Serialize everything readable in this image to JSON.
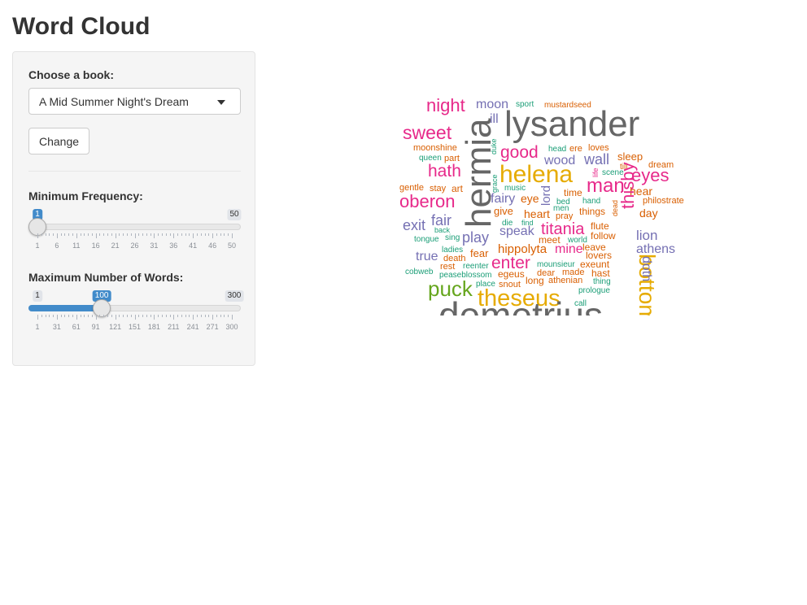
{
  "page": {
    "title": "Word Cloud"
  },
  "controls": {
    "book_label": "Choose a book:",
    "book_selected": "A Mid Summer Night's Dream",
    "change_label": "Change",
    "min_freq": {
      "label": "Minimum Frequency:",
      "min": 1,
      "max": 50,
      "value": 1,
      "min_text": "1",
      "max_text": "50",
      "value_text": "1",
      "ticks": [
        "1",
        "6",
        "11",
        "16",
        "21",
        "26",
        "31",
        "36",
        "41",
        "46",
        "50"
      ]
    },
    "max_words": {
      "label": "Maximum Number of Words:",
      "min": 1,
      "max": 300,
      "value": 100,
      "min_text": "1",
      "max_text": "300",
      "value_text": "100",
      "ticks": [
        "1",
        "31",
        "61",
        "91",
        "121",
        "151",
        "181",
        "211",
        "241",
        "271",
        "300"
      ]
    }
  },
  "colors": {
    "pink": "#e7298a",
    "orange": "#d95f02",
    "purple": "#7570b3",
    "green": "#1b9e77",
    "lime": "#66a61e",
    "gold": "#e6ab02",
    "gray": "#666666",
    "brown": "#a6761d",
    "slider_blue": "#428bca"
  },
  "wordcloud": {
    "words": [
      {
        "text": "night",
        "color": "pink"
      },
      {
        "text": "moon",
        "color": "purple"
      },
      {
        "text": "sport",
        "color": "green"
      },
      {
        "text": "mustardseed",
        "color": "orange"
      },
      {
        "text": "lysander",
        "color": "gray"
      },
      {
        "text": "sweet",
        "color": "pink"
      },
      {
        "text": "ill",
        "color": "purple"
      },
      {
        "text": "hermia",
        "color": "gray"
      },
      {
        "text": "moonshine",
        "color": "orange"
      },
      {
        "text": "duke",
        "color": "green"
      },
      {
        "text": "good",
        "color": "pink"
      },
      {
        "text": "head",
        "color": "green"
      },
      {
        "text": "ere",
        "color": "orange"
      },
      {
        "text": "loves",
        "color": "orange"
      },
      {
        "text": "queen",
        "color": "green"
      },
      {
        "text": "part",
        "color": "orange"
      },
      {
        "text": "wood",
        "color": "purple"
      },
      {
        "text": "wall",
        "color": "purple"
      },
      {
        "text": "sleep",
        "color": "orange"
      },
      {
        "text": "hath",
        "color": "pink"
      },
      {
        "text": "till",
        "color": "orange"
      },
      {
        "text": "dream",
        "color": "orange"
      },
      {
        "text": "helena",
        "color": "gold"
      },
      {
        "text": "life",
        "color": "pink"
      },
      {
        "text": "scene",
        "color": "green"
      },
      {
        "text": "eyes",
        "color": "pink"
      },
      {
        "text": "grace",
        "color": "green"
      },
      {
        "text": "man",
        "color": "pink"
      },
      {
        "text": "gentle",
        "color": "orange"
      },
      {
        "text": "stay",
        "color": "orange"
      },
      {
        "text": "art",
        "color": "orange"
      },
      {
        "text": "music",
        "color": "green"
      },
      {
        "text": "oberon",
        "color": "pink"
      },
      {
        "text": "lord",
        "color": "purple"
      },
      {
        "text": "time",
        "color": "orange"
      },
      {
        "text": "hear",
        "color": "orange"
      },
      {
        "text": "fairy",
        "color": "purple"
      },
      {
        "text": "eye",
        "color": "orange"
      },
      {
        "text": "hand",
        "color": "green"
      },
      {
        "text": "dead",
        "color": "orange"
      },
      {
        "text": "philostrate",
        "color": "orange"
      },
      {
        "text": "bed",
        "color": "green"
      },
      {
        "text": "give",
        "color": "orange"
      },
      {
        "text": "men",
        "color": "green"
      },
      {
        "text": "things",
        "color": "orange"
      },
      {
        "text": "day",
        "color": "orange"
      },
      {
        "text": "fair",
        "color": "purple"
      },
      {
        "text": "heart",
        "color": "orange"
      },
      {
        "text": "pray",
        "color": "orange"
      },
      {
        "text": "thisby",
        "color": "pink"
      },
      {
        "text": "exit",
        "color": "purple"
      },
      {
        "text": "die",
        "color": "green"
      },
      {
        "text": "find",
        "color": "green"
      },
      {
        "text": "titania",
        "color": "pink"
      },
      {
        "text": "flute",
        "color": "orange"
      },
      {
        "text": "back",
        "color": "green"
      },
      {
        "text": "speak",
        "color": "purple"
      },
      {
        "text": "lion",
        "color": "purple"
      },
      {
        "text": "tongue",
        "color": "green"
      },
      {
        "text": "sing",
        "color": "green"
      },
      {
        "text": "play",
        "color": "purple"
      },
      {
        "text": "meet",
        "color": "orange"
      },
      {
        "text": "world",
        "color": "green"
      },
      {
        "text": "follow",
        "color": "orange"
      },
      {
        "text": "athens",
        "color": "purple"
      },
      {
        "text": "ladies",
        "color": "green"
      },
      {
        "text": "hippolyta",
        "color": "orange"
      },
      {
        "text": "mine",
        "color": "pink"
      },
      {
        "text": "leave",
        "color": "orange"
      },
      {
        "text": "true",
        "color": "purple"
      },
      {
        "text": "death",
        "color": "orange"
      },
      {
        "text": "fear",
        "color": "orange"
      },
      {
        "text": "lovers",
        "color": "orange"
      },
      {
        "text": "bottom",
        "color": "gold"
      },
      {
        "text": "rest",
        "color": "orange"
      },
      {
        "text": "reenter",
        "color": "green"
      },
      {
        "text": "enter",
        "color": "pink"
      },
      {
        "text": "mounsieur",
        "color": "green"
      },
      {
        "text": "exeunt",
        "color": "orange"
      },
      {
        "text": "doth",
        "color": "purple"
      },
      {
        "text": "cobweb",
        "color": "green"
      },
      {
        "text": "peaseblossom",
        "color": "green"
      },
      {
        "text": "egeus",
        "color": "orange"
      },
      {
        "text": "dear",
        "color": "orange"
      },
      {
        "text": "made",
        "color": "orange"
      },
      {
        "text": "hast",
        "color": "orange"
      },
      {
        "text": "puck",
        "color": "lime"
      },
      {
        "text": "place",
        "color": "green"
      },
      {
        "text": "snout",
        "color": "orange"
      },
      {
        "text": "long",
        "color": "orange"
      },
      {
        "text": "athenian",
        "color": "orange"
      },
      {
        "text": "thing",
        "color": "green"
      },
      {
        "text": "theseus",
        "color": "gold"
      },
      {
        "text": "prologue",
        "color": "green"
      },
      {
        "text": "call",
        "color": "green"
      },
      {
        "text": "demetrius",
        "color": "gray"
      }
    ]
  }
}
